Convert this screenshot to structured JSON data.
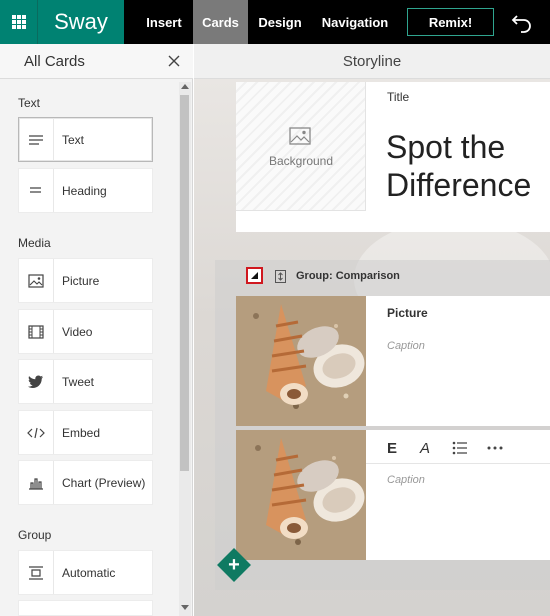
{
  "app": {
    "brand": "Sway"
  },
  "tabs": [
    {
      "label": "Insert"
    },
    {
      "label": "Cards"
    },
    {
      "label": "Design"
    },
    {
      "label": "Navigation"
    }
  ],
  "active_tab": "Cards",
  "remix_label": "Remix!",
  "left_panel": {
    "title": "All Cards",
    "sections": [
      {
        "label": "Text",
        "items": [
          {
            "label": "Text",
            "icon": "text-icon",
            "selected": true
          },
          {
            "label": "Heading",
            "icon": "heading-icon"
          }
        ]
      },
      {
        "label": "Media",
        "items": [
          {
            "label": "Picture",
            "icon": "picture-icon"
          },
          {
            "label": "Video",
            "icon": "video-icon"
          },
          {
            "label": "Tweet",
            "icon": "twitter-icon"
          },
          {
            "label": "Embed",
            "icon": "embed-icon"
          },
          {
            "label": "Chart (Preview)",
            "icon": "chart-icon"
          }
        ]
      },
      {
        "label": "Group",
        "items": [
          {
            "label": "Automatic",
            "icon": "automatic-icon"
          }
        ]
      }
    ]
  },
  "storyline": {
    "header": "Storyline",
    "title_card": {
      "background_label": "Background",
      "label": "Title",
      "text": "Spot the Difference"
    },
    "group": {
      "label": "Group: Comparison"
    },
    "picture_card": {
      "label": "Picture",
      "caption_placeholder": "Caption"
    },
    "second_card": {
      "caption_placeholder": "Caption",
      "toolbar": [
        "E",
        "A",
        "list",
        "more"
      ]
    }
  },
  "colors": {
    "accent": "#008272",
    "topbar": "#000000",
    "active_tab": "#7a7a7a",
    "highlight_border": "#d0181f"
  }
}
